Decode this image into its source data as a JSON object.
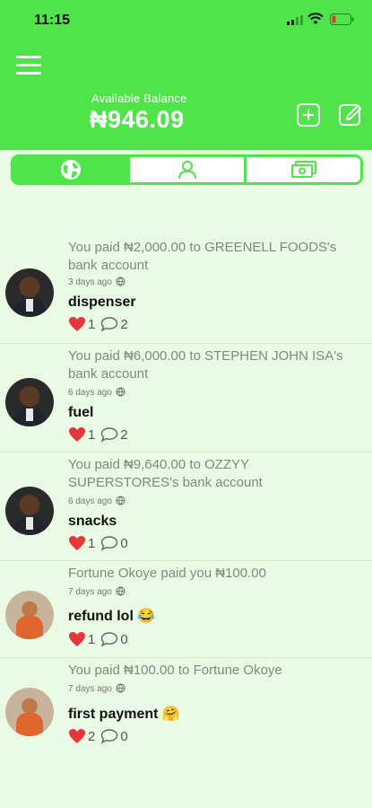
{
  "status": {
    "time": "11:15"
  },
  "header": {
    "balance_label": "Available Balance",
    "balance_value": "₦946.09",
    "accent": "#4fe54a"
  },
  "tabs": [
    {
      "icon": "globe-icon",
      "active": true
    },
    {
      "icon": "person-icon",
      "active": false
    },
    {
      "icon": "cash-icon",
      "active": false
    }
  ],
  "feed": [
    {
      "description": "You paid ₦2,000.00 to GREENELL FOODS's bank account",
      "time": "3 days ago",
      "note": "dispenser",
      "likes": "1",
      "comments": "2",
      "avatar": "male"
    },
    {
      "description": "You paid ₦6,000.00 to STEPHEN JOHN ISA's bank account",
      "time": "6 days ago",
      "note": "fuel",
      "likes": "1",
      "comments": "2",
      "avatar": "male"
    },
    {
      "description": "You paid ₦9,640.00 to OZZYY SUPERSTORES's bank account",
      "time": "6 days ago",
      "note": "snacks",
      "likes": "1",
      "comments": "0",
      "avatar": "male"
    },
    {
      "description": "Fortune Okoye paid you ₦100.00",
      "time": "7 days ago",
      "note": "refund lol 😂",
      "likes": "1",
      "comments": "0",
      "avatar": "female"
    },
    {
      "description": "You paid ₦100.00 to Fortune Okoye",
      "time": "7 days ago",
      "note": "first payment 🤗",
      "likes": "2",
      "comments": "0",
      "avatar": "female"
    }
  ]
}
